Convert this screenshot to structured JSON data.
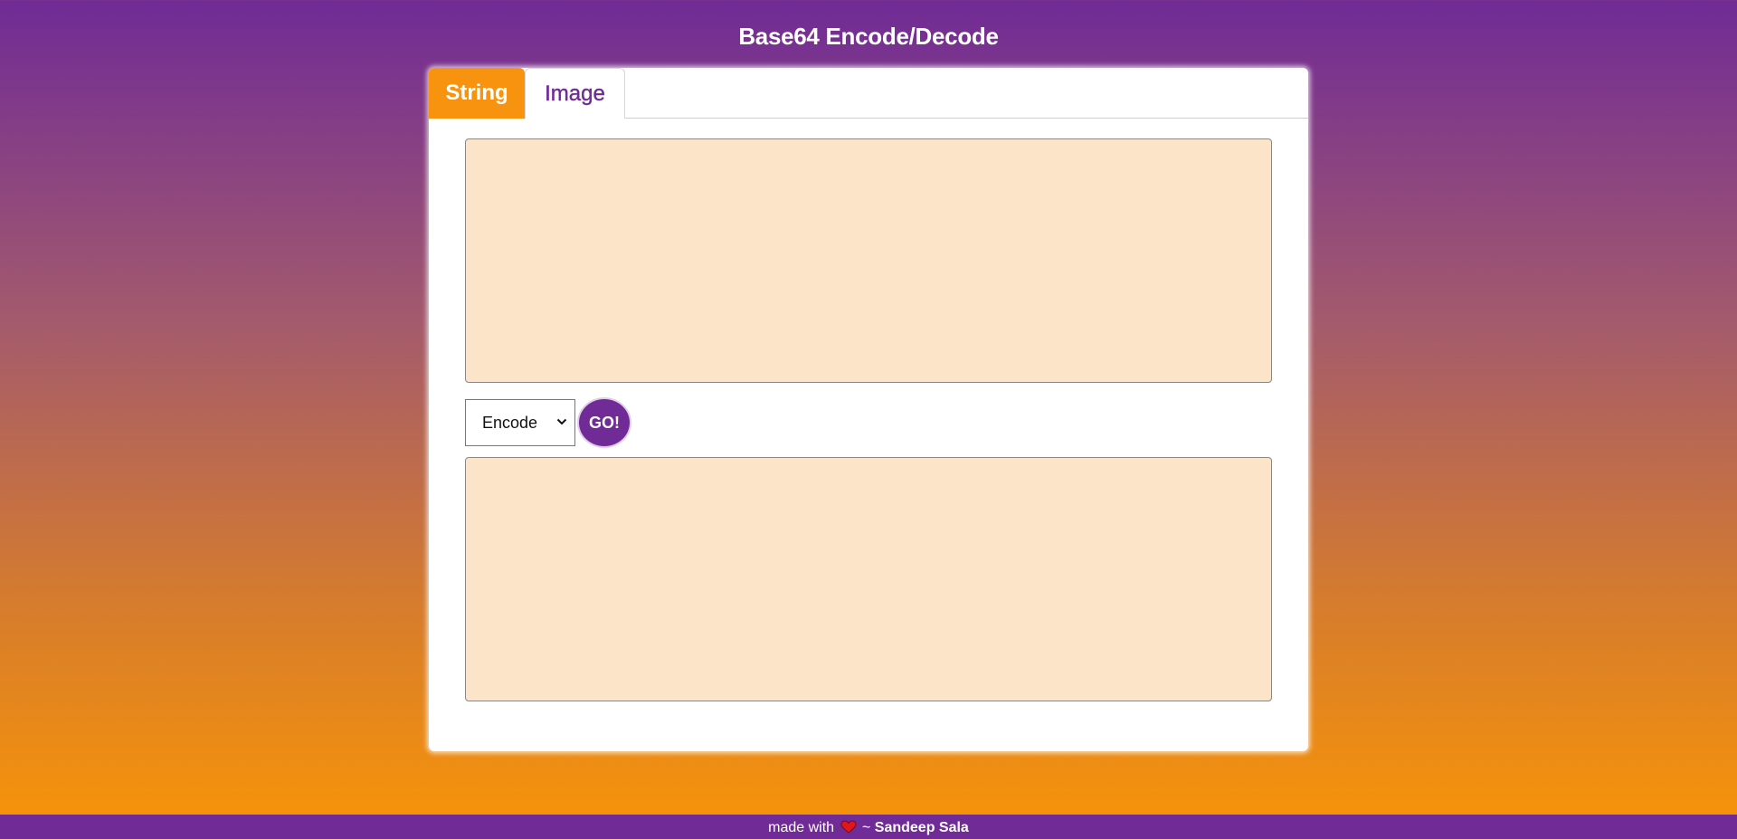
{
  "header": {
    "title": "Base64 Encode/Decode"
  },
  "tabs": [
    {
      "label": "String",
      "active": true
    },
    {
      "label": "Image",
      "active": false
    }
  ],
  "input": {
    "value": "",
    "placeholder": ""
  },
  "controls": {
    "mode_selected": "Encode",
    "go_label": "GO!"
  },
  "output": {
    "value": "",
    "placeholder": ""
  },
  "footer": {
    "prefix": "made with",
    "icon": "heart-icon",
    "separator": "~",
    "author": "Sandeep Sala"
  },
  "colors": {
    "primary_purple": "#702b96",
    "accent_orange": "#f7930f",
    "textarea_bg": "#fce4c9",
    "heart_red": "#e0161c"
  }
}
